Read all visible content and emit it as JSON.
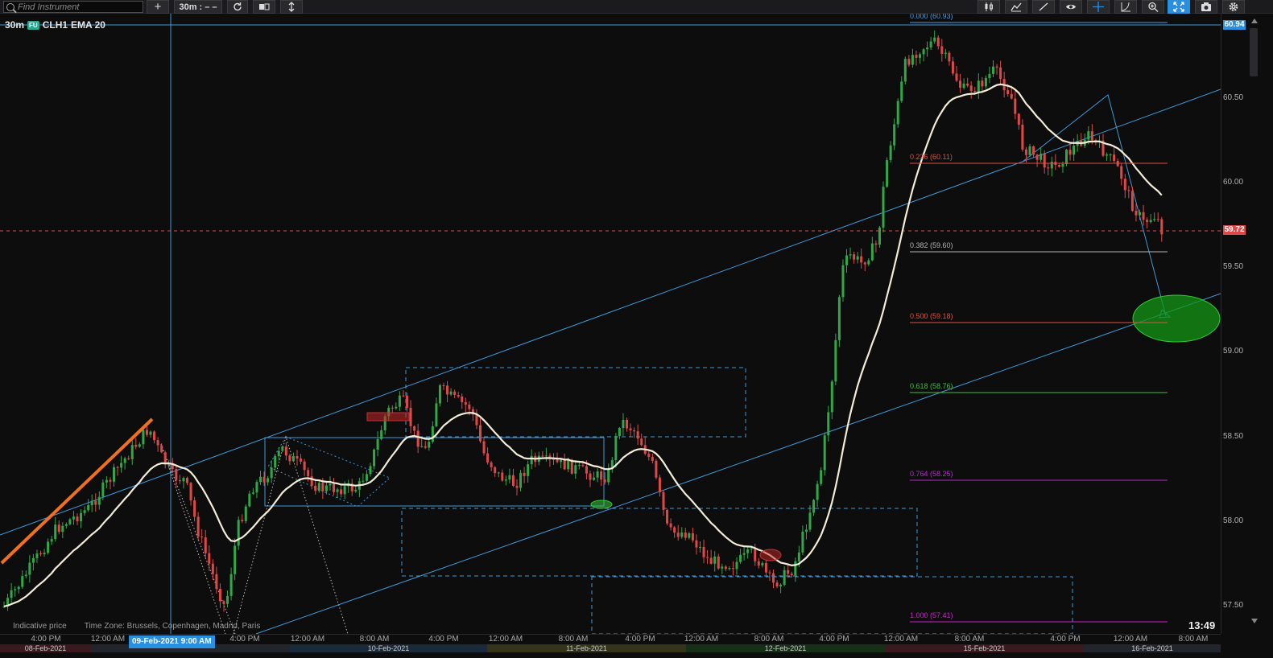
{
  "toolbar": {
    "search_placeholder": "Find Instrument",
    "add_symbol": "+",
    "timeframe": "30m : – –"
  },
  "chart": {
    "timeframe": "30m",
    "badge": "FU",
    "symbol": "CLH1",
    "indicator": "EMA 20",
    "footer_price_note": "Indicative price",
    "timezone": "Time Zone: Brussels, Copenhagen, Madrid, Paris",
    "clock": "13:49",
    "last_price_tag": "59.72",
    "top_price_tag": "60.94",
    "cursor_time_tag": "09-Feb-2021 9:00 AM"
  },
  "price_axis": [
    "60.50",
    "60.00",
    "59.50",
    "59.00",
    "58.50",
    "58.00",
    "57.50"
  ],
  "fib_levels": [
    {
      "label": "0.000 (60.93)",
      "color": "#4a9bd8"
    },
    {
      "label": "0.236 (60.11)",
      "color": "#e05040"
    },
    {
      "label": "0.382 (59.60)",
      "color": "#b5b5b5"
    },
    {
      "label": "0.500 (59.18)",
      "color": "#e05040"
    },
    {
      "label": "0.618 (58.76)",
      "color": "#3fbf3f"
    },
    {
      "label": "0.764 (58.25)",
      "color": "#b030c0"
    },
    {
      "label": "1.000 (57.41)",
      "color": "#d020d0"
    }
  ],
  "time_labels": [
    "4:00 PM",
    "12:00 AM",
    "8:00 AM",
    "4:00 PM",
    "12:00 AM",
    "8:00 AM",
    "4:00 PM",
    "12:00 AM",
    "8:00 AM",
    "4:00 PM",
    "12:00 AM",
    "8:00 AM",
    "4:00 PM",
    "12:00 AM",
    "8:00 AM",
    "4:00 PM",
    "12:00 AM",
    "8:00 AM",
    "4:00 PM"
  ],
  "date_strips": [
    {
      "label": "08-Feb-2021",
      "color": "#3a1a1e"
    },
    {
      "label": "",
      "color": "#22262c"
    },
    {
      "label": "10-Feb-2021",
      "color": "#1a2a3a"
    },
    {
      "label": "11-Feb-2021",
      "color": "#34341a"
    },
    {
      "label": "12-Feb-2021",
      "color": "#163018"
    },
    {
      "label": "15-Feb-2021",
      "color": "#3a1a1e"
    },
    {
      "label": "16-Feb-2021",
      "color": "#22262c"
    }
  ],
  "colors": {
    "bull": "#2fa84a",
    "bear": "#e04848",
    "ema": "#f2ecd8",
    "trend": "#3d9ad8",
    "orange_line": "#f07020",
    "accent": "#2b8fe0"
  }
}
